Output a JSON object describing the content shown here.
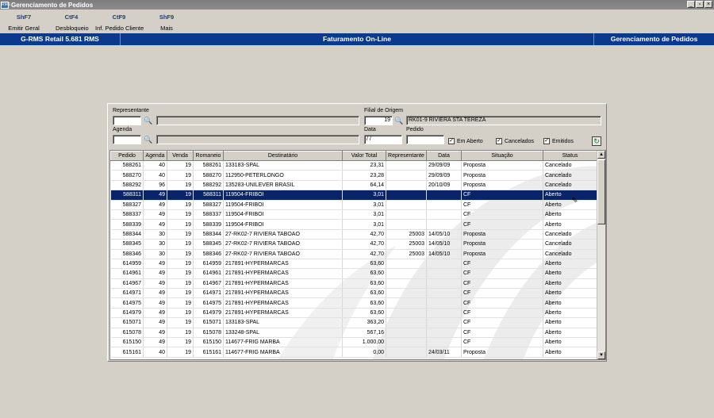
{
  "window": {
    "title": "Gerenciamento de Pedidos",
    "icon_label": "RMS",
    "controls": [
      "_",
      "▫",
      "×"
    ]
  },
  "toolbar": {
    "items": [
      {
        "key": "ShF7",
        "label": "Emitir Geral"
      },
      {
        "key": "CtF4",
        "label": "Desbloqueio"
      },
      {
        "key": "CtF9",
        "label": "Inf. Pedido Cliente"
      },
      {
        "key": "ShF9",
        "label": "Mais"
      }
    ]
  },
  "status_bar": {
    "left": "G-RMS Retail 5.681 RMS",
    "center": "Faturamento On-Line",
    "right": "Gerenciamento de Pedidos"
  },
  "filters": {
    "representante_label": "Representante",
    "representante_code": "",
    "representante_name": "",
    "filial_label": "Filial de Origem",
    "filial_code": "19",
    "filial_name": "RK01-9 RIVIERA STA TEREZA",
    "agenda_label": "Agenda",
    "agenda_code": "",
    "agenda_name": "",
    "data_label": "Data",
    "data_value": " / /",
    "pedido_label": "Pedido",
    "pedido_value": "",
    "chk_em_aberto": {
      "label": "Em Aberto",
      "checked": true
    },
    "chk_cancelados": {
      "label": "Cancelados",
      "checked": true
    },
    "chk_emitidos": {
      "label": "Emitidos",
      "checked": true
    }
  },
  "grid": {
    "columns": [
      "Pedido",
      "Agenda",
      "Venda",
      "Romaneio",
      "Destinatário",
      "Valor Total",
      "Representante",
      "Data",
      "Situação",
      "Status"
    ],
    "selected_row": 3,
    "rows": [
      [
        "588261",
        "40",
        "19",
        "588261",
        "133183-SPAL",
        "23,31",
        "",
        "29/09/09",
        "Proposta",
        "Cancelado"
      ],
      [
        "588270",
        "40",
        "19",
        "588270",
        "112950-PETERLONGO",
        "23,28",
        "",
        "29/09/09",
        "Proposta",
        "Cancelado"
      ],
      [
        "588292",
        "96",
        "19",
        "588292",
        "135283-UNILEVER BRASIL",
        "64,14",
        "",
        "20/10/09",
        "Proposta",
        "Cancelado"
      ],
      [
        "588311",
        "49",
        "19",
        "588311",
        "119504-FRIBOI",
        "3,01",
        "",
        "",
        "CF",
        "Aberto"
      ],
      [
        "588327",
        "49",
        "19",
        "588327",
        "119504-FRIBOI",
        "3,01",
        "",
        "",
        "CF",
        "Aberto"
      ],
      [
        "588337",
        "49",
        "19",
        "588337",
        "119504-FRIBOI",
        "3,01",
        "",
        "",
        "CF",
        "Aberto"
      ],
      [
        "588339",
        "49",
        "19",
        "588339",
        "119504-FRIBOI",
        "3,01",
        "",
        "",
        "CF",
        "Aberto"
      ],
      [
        "588344",
        "30",
        "19",
        "588344",
        "27-RK02-7 RIVIERA TABOAO",
        "42,70",
        "25003",
        "14/05/10",
        "Proposta",
        "Cancelado"
      ],
      [
        "588345",
        "30",
        "19",
        "588345",
        "27-RK02-7 RIVIERA TABOAO",
        "42,70",
        "25003",
        "14/05/10",
        "Proposta",
        "Cancelado"
      ],
      [
        "588346",
        "30",
        "19",
        "588346",
        "27-RK02-7 RIVIERA TABOAO",
        "42,70",
        "25003",
        "14/05/10",
        "Proposta",
        "Cancelado"
      ],
      [
        "614959",
        "49",
        "19",
        "614959",
        "217891-HYPERMARCAS",
        "63,60",
        "",
        "",
        "CF",
        "Aberto"
      ],
      [
        "614961",
        "49",
        "19",
        "614961",
        "217891-HYPERMARCAS",
        "63,60",
        "",
        "",
        "CF",
        "Aberto"
      ],
      [
        "614967",
        "49",
        "19",
        "614967",
        "217891-HYPERMARCAS",
        "63,60",
        "",
        "",
        "CF",
        "Aberto"
      ],
      [
        "614971",
        "49",
        "19",
        "614971",
        "217891-HYPERMARCAS",
        "63,60",
        "",
        "",
        "CF",
        "Aberto"
      ],
      [
        "614975",
        "49",
        "19",
        "614975",
        "217891-HYPERMARCAS",
        "63,60",
        "",
        "",
        "CF",
        "Aberto"
      ],
      [
        "614979",
        "49",
        "19",
        "614979",
        "217891-HYPERMARCAS",
        "63,60",
        "",
        "",
        "CF",
        "Aberto"
      ],
      [
        "615071",
        "49",
        "19",
        "615071",
        "133183-SPAL",
        "363,20",
        "",
        "",
        "CF",
        "Aberto"
      ],
      [
        "615078",
        "49",
        "19",
        "615078",
        "133248-SPAL",
        "567,16",
        "",
        "",
        "CF",
        "Aberto"
      ],
      [
        "615150",
        "49",
        "19",
        "615150",
        "114677-FRIG MARBA",
        "1.000,00",
        "",
        "",
        "CF",
        "Aberto"
      ],
      [
        "615161",
        "40",
        "19",
        "615161",
        "114677-FRIG MARBA",
        "0,00",
        "",
        "24/03/11",
        "Proposta",
        "Aberto"
      ]
    ]
  },
  "colors": {
    "accent": "#0a3a8c",
    "selection": "#0a246a",
    "background": "#d4d0c8"
  }
}
